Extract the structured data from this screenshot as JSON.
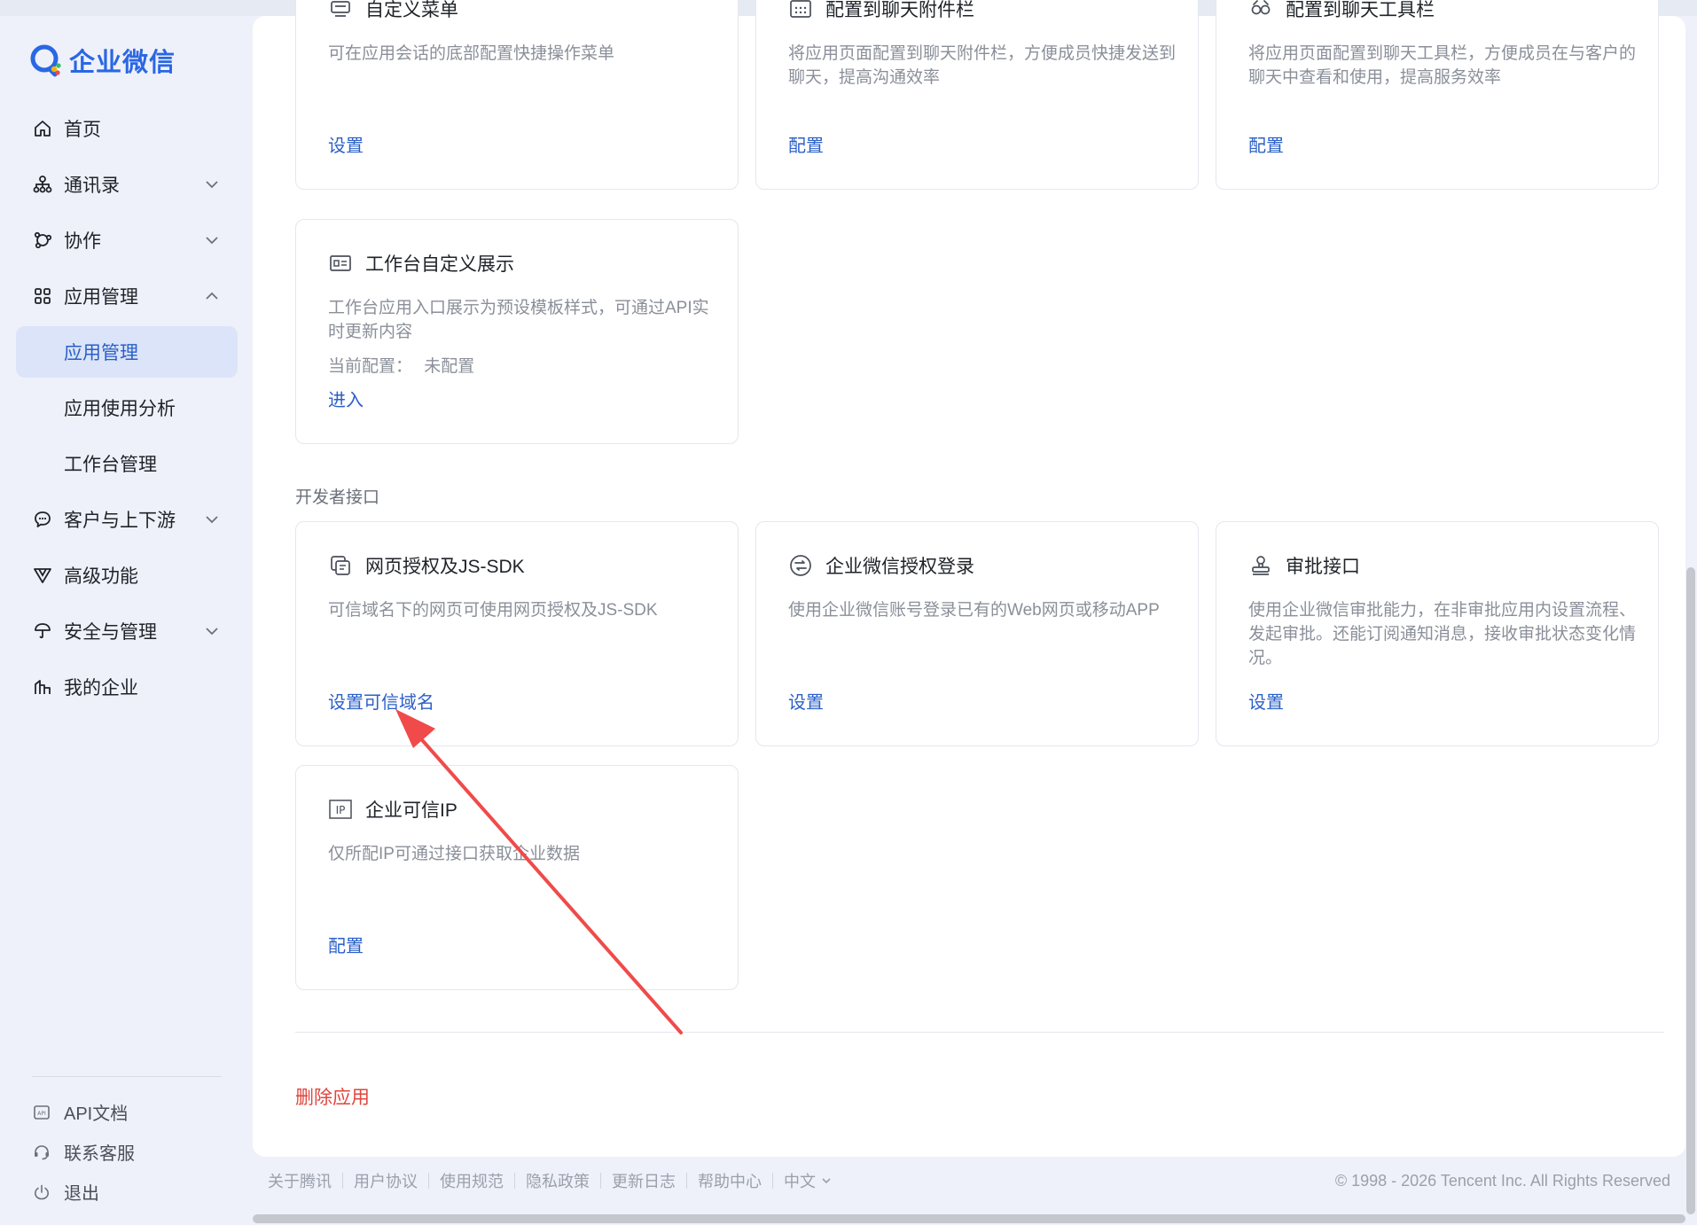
{
  "brand": {
    "name": "企业微信"
  },
  "nav": {
    "home": "首页",
    "contacts": "通讯录",
    "collab": "协作",
    "apps": "应用管理",
    "apps_sub": [
      "应用管理",
      "应用使用分析",
      "工作台管理"
    ],
    "customers": "客户与上下游",
    "advanced": "高级功能",
    "security": "安全与管理",
    "company": "我的企业"
  },
  "sidebar_bottom": {
    "api_docs": "API文档",
    "support": "联系客服",
    "logout": "退出"
  },
  "cards_top": [
    {
      "title": "自定义菜单",
      "desc": "可在应用会话的底部配置快捷操作菜单",
      "link": "设置",
      "icon": "menu-icon"
    },
    {
      "title": "配置到聊天附件栏",
      "desc": "将应用页面配置到聊天附件栏，方便成员快捷发送到聊天，提高沟通效率",
      "link": "配置",
      "icon": "attachment-bar-icon"
    },
    {
      "title": "配置到聊天工具栏",
      "desc": "将应用页面配置到聊天工具栏，方便成员在与客户的聊天中查看和使用，提高服务效率",
      "link": "配置",
      "icon": "toolbar-icon"
    }
  ],
  "workbench_card": {
    "title": "工作台自定义展示",
    "desc": "工作台应用入口展示为预设模板样式，可通过API实时更新内容",
    "config_label": "当前配置：",
    "config_value": "未配置",
    "link": "进入",
    "icon": "workbench-display-icon"
  },
  "developer_section": {
    "title": "开发者接口"
  },
  "dev_cards": [
    {
      "title": "网页授权及JS-SDK",
      "desc": "可信域名下的网页可使用网页授权及JS-SDK",
      "link": "设置可信域名",
      "icon": "web-auth-icon"
    },
    {
      "title": "企业微信授权登录",
      "desc": "使用企业微信账号登录已有的Web网页或移动APP",
      "link": "设置",
      "icon": "login-auth-icon"
    },
    {
      "title": "审批接口",
      "desc": "使用企业微信审批能力，在非审批应用内设置流程、发起审批。还能订阅通知消息，接收审批状态变化情况。",
      "link": "设置",
      "icon": "approval-icon"
    },
    {
      "title": "企业可信IP",
      "desc": "仅所配IP可通过接口获取企业数据",
      "link": "配置",
      "icon": "ip-icon"
    }
  ],
  "delete_app": "删除应用",
  "footer": {
    "links": [
      "关于腾讯",
      "用户协议",
      "使用规范",
      "隐私政策",
      "更新日志",
      "帮助中心"
    ],
    "language": "中文",
    "copyright": "© 1998 - 2026 Tencent Inc. All Rights Reserved"
  },
  "colors": {
    "accent": "#2a5fc8",
    "danger": "#e0453d",
    "annotation_arrow": "#f04a4a"
  }
}
